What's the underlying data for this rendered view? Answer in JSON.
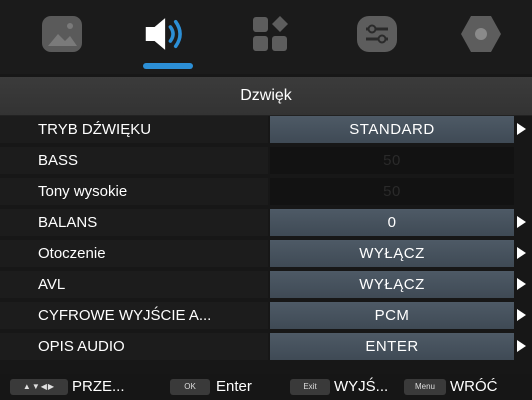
{
  "tabs": [
    {
      "name": "picture-icon",
      "selected": false
    },
    {
      "name": "sound-icon",
      "selected": true
    },
    {
      "name": "apps-icon",
      "selected": false
    },
    {
      "name": "settings-sliders-icon",
      "selected": false
    },
    {
      "name": "lock-icon",
      "selected": false
    }
  ],
  "header": {
    "title": "Dzwięk"
  },
  "menu": {
    "items": [
      {
        "label": "TRYB DŹWIĘKU",
        "value": "STANDARD"
      },
      {
        "label": "BASS",
        "value": "50"
      },
      {
        "label": "Tony wysokie",
        "value": "50"
      },
      {
        "label": "BALANS",
        "value": "0"
      },
      {
        "label": "Otoczenie",
        "value": "WYŁĄCZ"
      },
      {
        "label": "AVL",
        "value": "WYŁĄCZ"
      },
      {
        "label": "CYFROWE WYJŚCIE A...",
        "value": "PCM"
      },
      {
        "label": "OPIS AUDIO",
        "value": "ENTER"
      }
    ]
  },
  "footer": {
    "nav_key": "▲▼◀▶",
    "nav_text": "PRZE...",
    "ok_key": "OK",
    "ok_text": "Enter",
    "exit_key": "Exit",
    "exit_text": "WYJŚ...",
    "menu_key": "Menu",
    "menu_text": "WRÓĆ"
  },
  "colors": {
    "accent": "#2c8fd6",
    "value_cell": "#4a5561",
    "background": "#171717"
  }
}
